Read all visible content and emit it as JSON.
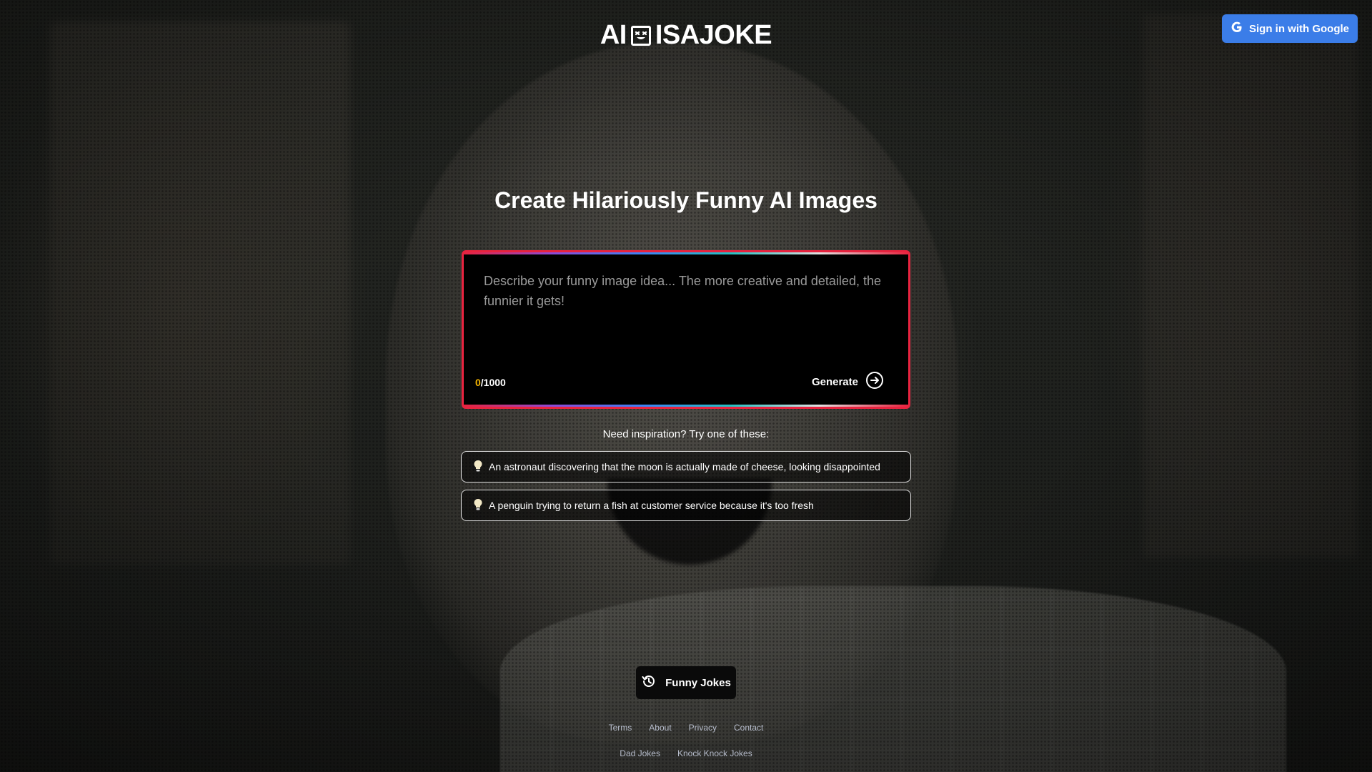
{
  "header": {
    "logo": {
      "left": "AI",
      "right": "ISAJOKE"
    },
    "signin_label": "Sign in with Google"
  },
  "main": {
    "title": "Create Hilariously Funny AI Images",
    "prompt": {
      "placeholder": "Describe your funny image idea... The more creative and detailed, the funnier it gets!",
      "value": "",
      "count_current": "0",
      "count_max": "/1000"
    },
    "generate_label": "Generate",
    "inspiration_heading": "Need inspiration? Try one of these:",
    "suggestions": [
      "An astronaut discovering that the moon is actually made of cheese, looking disappointed",
      "A penguin trying to return a fish at customer service because it's too fresh"
    ],
    "funny_jokes_label": "Funny Jokes"
  },
  "footer": {
    "links": [
      "Terms",
      "About",
      "Privacy",
      "Contact"
    ],
    "links2": [
      "Dad Jokes",
      "Knock Knock Jokes"
    ]
  },
  "colors": {
    "accent_blue": "#3b7de8",
    "box_border": "#e8233f",
    "count_highlight": "#f4b400"
  },
  "icons": {
    "google": "google-icon",
    "generate": "arrow-circle-right-icon",
    "suggestion": "lightbulb-icon",
    "history": "history-icon",
    "logo_face": "smiley-face-icon"
  }
}
